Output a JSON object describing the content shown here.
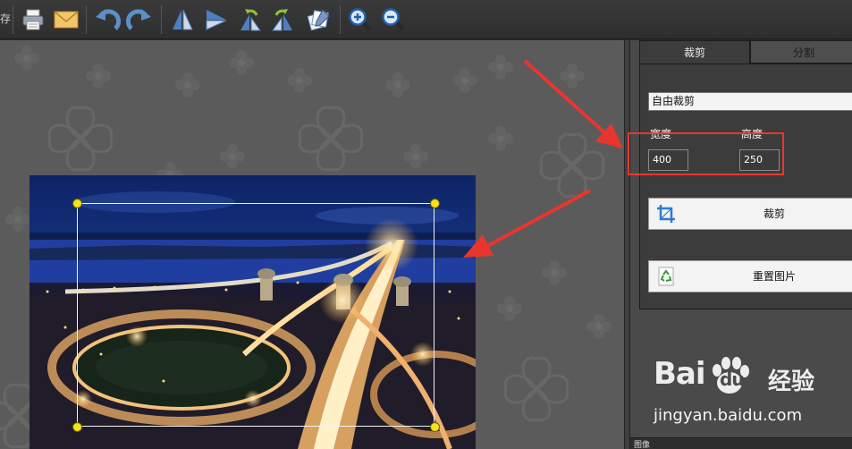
{
  "toolbar": {
    "cut_text": "存",
    "icons": [
      "print-icon",
      "email-icon",
      "undo-icon",
      "redo-icon",
      "flip-vertical-icon",
      "flip-horizontal-icon",
      "rotate-left-icon",
      "rotate-right-icon",
      "effects-icon",
      "zoom-in-icon",
      "zoom-out-icon"
    ]
  },
  "panel": {
    "tabs": [
      {
        "label": "裁剪",
        "active": true
      },
      {
        "label": "分割",
        "active": false
      }
    ],
    "crop_mode": "自由裁剪",
    "width_label": "宽度",
    "height_label": "高度",
    "width_value": "400",
    "height_value": "250",
    "crop_button_label": "裁剪",
    "reset_button_label": "重置图片",
    "bottom_label": "图像"
  },
  "watermark": {
    "logo_text": "Bai",
    "logo_text_2": "du",
    "cn_text": "经验",
    "url": "jingyan.baidu.com"
  },
  "colors": {
    "accent_red": "#e8362f",
    "handle_yellow": "#f5e31b",
    "canvas_gray": "#5b5b5b"
  }
}
